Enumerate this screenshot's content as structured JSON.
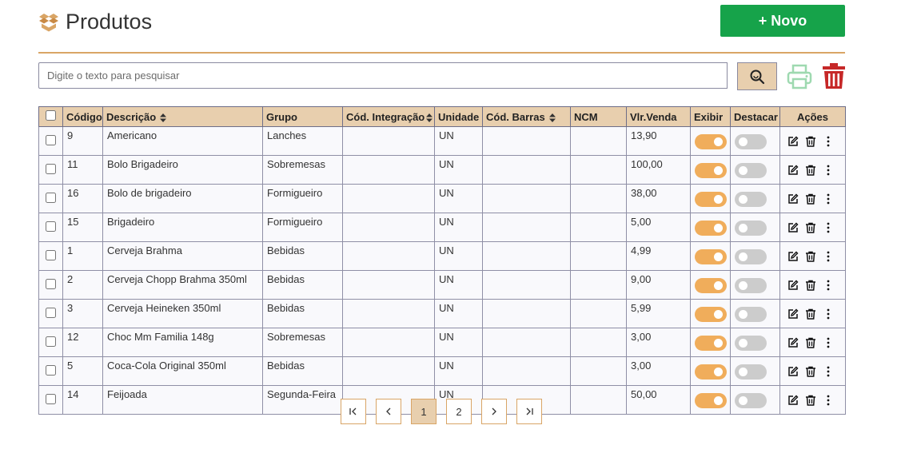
{
  "header": {
    "title": "Produtos",
    "new_button": "+ Novo"
  },
  "search": {
    "placeholder": "Digite o texto para pesquisar",
    "value": ""
  },
  "colors": {
    "accent": "#e8cfae",
    "border": "#d9a566",
    "primary_button": "#16a34a",
    "print": "#9ed9b0",
    "delete": "#c62828",
    "toggle_on": "#f0ad5b",
    "toggle_off": "#cccccc"
  },
  "table": {
    "columns": [
      "Código",
      "Descrição",
      "Grupo",
      "Cód. Integração",
      "Unidade",
      "Cód. Barras",
      "NCM",
      "Vlr.Venda",
      "Exibir",
      "Destacar",
      "Ações"
    ],
    "rows": [
      {
        "codigo": "9",
        "descricao": "Americano",
        "grupo": "Lanches",
        "integracao": "",
        "unidade": "UN",
        "barras": "",
        "ncm": "",
        "valor": "13,90",
        "exibir": true,
        "destacar": false
      },
      {
        "codigo": "11",
        "descricao": "Bolo Brigadeiro",
        "grupo": "Sobremesas",
        "integracao": "",
        "unidade": "UN",
        "barras": "",
        "ncm": "",
        "valor": "100,00",
        "exibir": true,
        "destacar": false
      },
      {
        "codigo": "16",
        "descricao": "Bolo de brigadeiro",
        "grupo": "Formigueiro",
        "integracao": "",
        "unidade": "UN",
        "barras": "",
        "ncm": "",
        "valor": "38,00",
        "exibir": true,
        "destacar": false
      },
      {
        "codigo": "15",
        "descricao": "Brigadeiro",
        "grupo": "Formigueiro",
        "integracao": "",
        "unidade": "UN",
        "barras": "",
        "ncm": "",
        "valor": "5,00",
        "exibir": true,
        "destacar": false
      },
      {
        "codigo": "1",
        "descricao": "Cerveja Brahma",
        "grupo": "Bebidas",
        "integracao": "",
        "unidade": "UN",
        "barras": "",
        "ncm": "",
        "valor": "4,99",
        "exibir": true,
        "destacar": false
      },
      {
        "codigo": "2",
        "descricao": "Cerveja Chopp Brahma 350ml",
        "grupo": "Bebidas",
        "integracao": "",
        "unidade": "UN",
        "barras": "",
        "ncm": "",
        "valor": "9,00",
        "exibir": true,
        "destacar": false
      },
      {
        "codigo": "3",
        "descricao": "Cerveja Heineken 350ml",
        "grupo": "Bebidas",
        "integracao": "",
        "unidade": "UN",
        "barras": "",
        "ncm": "",
        "valor": "5,99",
        "exibir": true,
        "destacar": false
      },
      {
        "codigo": "12",
        "descricao": "Choc Mm Familia 148g",
        "grupo": "Sobremesas",
        "integracao": "",
        "unidade": "UN",
        "barras": "",
        "ncm": "",
        "valor": "3,00",
        "exibir": true,
        "destacar": false
      },
      {
        "codigo": "5",
        "descricao": "Coca-Cola Original 350ml",
        "grupo": "Bebidas",
        "integracao": "",
        "unidade": "UN",
        "barras": "",
        "ncm": "",
        "valor": "3,00",
        "exibir": true,
        "destacar": false
      },
      {
        "codigo": "14",
        "descricao": "Feijoada",
        "grupo": "Segunda-Feira",
        "integracao": "",
        "unidade": "UN",
        "barras": "",
        "ncm": "",
        "valor": "50,00",
        "exibir": true,
        "destacar": false
      }
    ]
  },
  "pagination": {
    "first": "|<",
    "prev": "<",
    "pages": [
      "1",
      "2"
    ],
    "active": "1",
    "next": ">",
    "last": ">|"
  }
}
